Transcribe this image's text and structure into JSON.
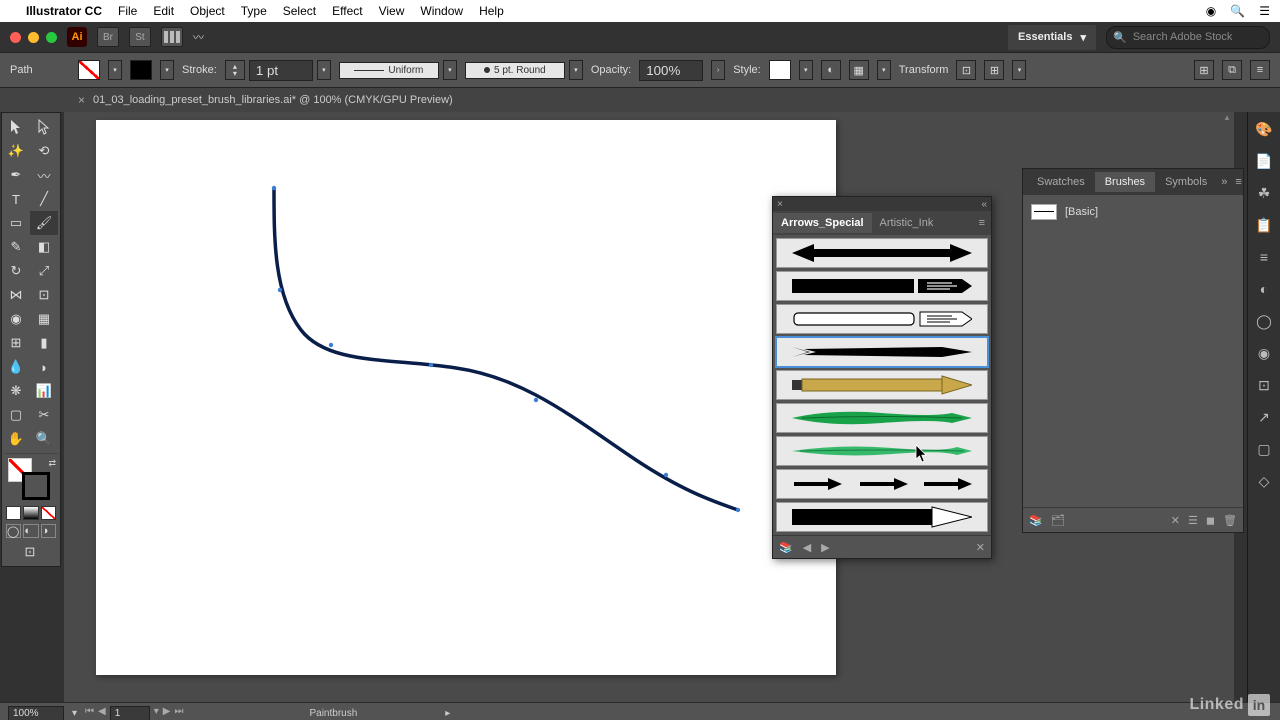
{
  "menubar": {
    "apple": "",
    "app_name": "Illustrator CC",
    "items": [
      "File",
      "Edit",
      "Object",
      "Type",
      "Select",
      "Effect",
      "View",
      "Window",
      "Help"
    ]
  },
  "header": {
    "essentials": "Essentials",
    "search_placeholder": "Search Adobe Stock"
  },
  "control_bar": {
    "tool": "Path",
    "stroke_label": "Stroke:",
    "stroke_weight": "1 pt",
    "stroke_profile": "Uniform",
    "brush_def": "5 pt. Round",
    "opacity_label": "Opacity:",
    "opacity_value": "100%",
    "style_label": "Style:",
    "transform": "Transform"
  },
  "doc_tab": {
    "title": "01_03_loading_preset_brush_libraries.ai* @ 100% (CMYK/GPU Preview)"
  },
  "brushes_panel": {
    "tabs": [
      "Swatches",
      "Brushes",
      "Symbols"
    ],
    "active_tab": "Brushes",
    "basic_label": "[Basic]"
  },
  "float_panel": {
    "tabs": [
      "Arrows_Special",
      "Artistic_Ink"
    ],
    "active_tab": "Arrows_Special",
    "brushes": [
      {
        "id": "arrow-double-black",
        "kind": "double_arrow",
        "fill": "#000",
        "selected": false
      },
      {
        "id": "arrow-hand-black",
        "kind": "hand_block",
        "fill": "#000",
        "selected": false
      },
      {
        "id": "arrow-hand-outline",
        "kind": "hand_block",
        "fill": "#fff",
        "stroke": "#000",
        "selected": false
      },
      {
        "id": "arrow-swallowtail",
        "kind": "swallow",
        "fill": "#000",
        "selected": true
      },
      {
        "id": "arrow-brass",
        "kind": "solid_arrow",
        "fill": "#c8a84a",
        "selected": false
      },
      {
        "id": "arrow-green-dark",
        "kind": "leaf_arrow",
        "fill": "#1aa24a",
        "selected": false
      },
      {
        "id": "arrow-green-light",
        "kind": "leaf_arrow",
        "fill": "#37b96b",
        "selected": false
      },
      {
        "id": "arrow-triple",
        "kind": "triple",
        "fill": "#000",
        "selected": false
      },
      {
        "id": "arrow-blocky-white",
        "kind": "block_white",
        "fill": "#000",
        "selected": false
      }
    ]
  },
  "status": {
    "zoom": "100%",
    "page": "1",
    "tool_name": "Paintbrush"
  },
  "watermark": {
    "brand": "Linked",
    "box": "in"
  }
}
